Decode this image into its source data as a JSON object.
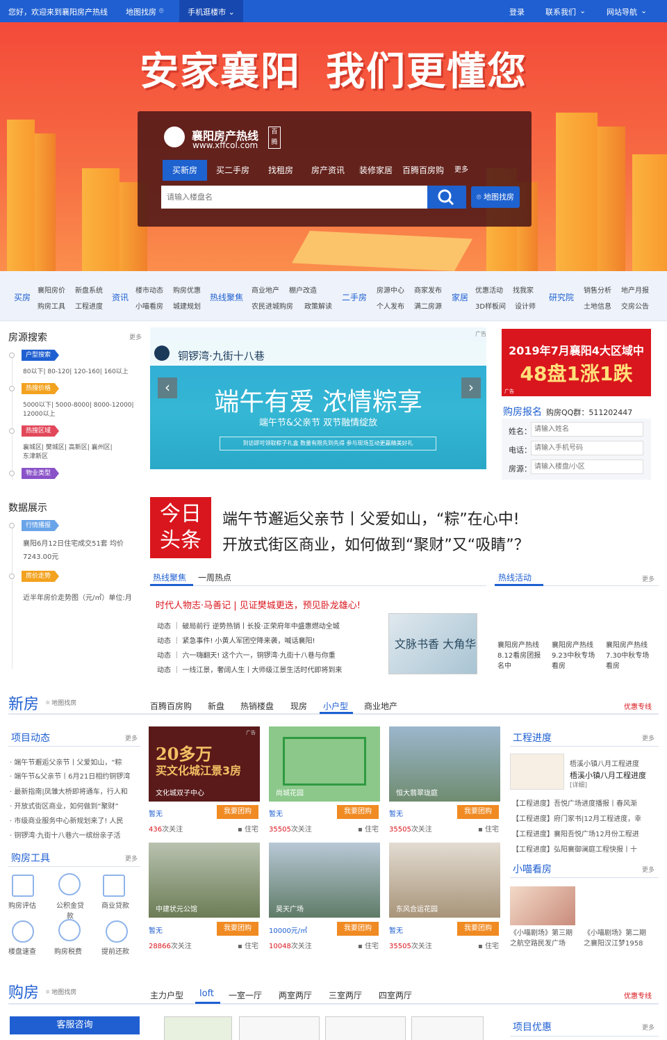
{
  "topbar": {
    "welcome": "您好，欢迎来到襄阳房产热线",
    "map_search": "地图找房",
    "mobile": "手机逛楼市",
    "login": "登录",
    "contact": "联系我们",
    "site_nav": "网站导航"
  },
  "hero": {
    "slogan_left": "安家襄阳",
    "slogan_right": "我们更懂您",
    "logo_name": "襄阳房产热线",
    "logo_url": "www.xffcol.com",
    "logo_seal": "百腾",
    "tabs": [
      "买新房",
      "买二手房",
      "找租房",
      "房产资讯",
      "装修家居",
      "百腾百房购",
      "更多"
    ],
    "search_placeholder": "请输入楼盘名",
    "map_button": "地图找房"
  },
  "catnav": [
    {
      "title": "买房",
      "items": [
        "襄阳房价",
        "新盘系统",
        "购房工具",
        "工程进度"
      ]
    },
    {
      "title": "资讯",
      "items": [
        "楼市动态",
        "购房优惠",
        "小喵看房",
        "城建规划"
      ]
    },
    {
      "title": "热线聚焦",
      "items": [
        "商业地产",
        "棚户改造",
        "农民进城购房",
        "政策解读"
      ]
    },
    {
      "title": "二手房",
      "items": [
        "房源中心",
        "商家发布",
        "个人发布",
        "满二房源"
      ]
    },
    {
      "title": "家居",
      "items": [
        "优惠活动",
        "找我家",
        "3D样板间",
        "设计师"
      ]
    },
    {
      "title": "研究院",
      "items": [
        "销售分析",
        "地产月报",
        "土地信息",
        "交房公告"
      ]
    }
  ],
  "house_search": {
    "title": "房源搜索",
    "more": "更多",
    "groups": [
      {
        "tag": "户型搜索",
        "color": "#1f5fd1",
        "lines": [
          "80以下| 80-120| 120-160| 160以上"
        ]
      },
      {
        "tag": "热搜价格",
        "color": "#f3a21f",
        "lines": [
          "5000以下| 5000-8000| 8000-12000|",
          "12000以上"
        ]
      },
      {
        "tag": "热搜区域",
        "color": "#e2485a",
        "lines": [
          "襄城区| 樊城区| 高新区| 襄州区|",
          "东津新区"
        ]
      },
      {
        "tag": "物业类型",
        "color": "#8a52c9",
        "lines": []
      }
    ]
  },
  "data_show": {
    "title": "数据展示",
    "g1": {
      "tag": "行情播报",
      "color": "#6aa4e8",
      "lines": [
        "襄阳6月12日住宅成交51套 均价",
        "7243.00元"
      ]
    },
    "g2": {
      "tag": "房价走势",
      "color": "#f3a21f",
      "lines": [
        "近半年房价走势图（元/㎡）单位:月"
      ]
    }
  },
  "banner": {
    "brand": "铜锣湾·九街十八巷",
    "headline": "端午有爱 浓情粽享",
    "sub": "端午节&父亲节 双节融情绽放",
    "note": "到访即可领取粽子礼盒 数量有限先到先得 参与现场互动更赢精美好礼",
    "ad": "广告"
  },
  "red_ad": {
    "line1": "2019年7月襄阳4大区域中",
    "line2": "48盘1涨1跌",
    "ad": "广告"
  },
  "signup": {
    "title": "购房报名",
    "qq": "购房QQ群：511202447",
    "fields": [
      {
        "label": "姓名：",
        "placeholder": "请输入姓名"
      },
      {
        "label": "电话：",
        "placeholder": "请输入手机号码"
      },
      {
        "label": "房源：",
        "placeholder": "请输入楼盘/小区"
      }
    ]
  },
  "headline": {
    "box1": "今日",
    "box2": "头条",
    "line1": "端午节邂逅父亲节丨父爱如山，“粽”在心中!",
    "line2": "开放式街区商业，如何做到“聚财”又“吸睛”？"
  },
  "focus": {
    "tab1": "热线聚焦",
    "tab2": "一周热点",
    "lead": "时代人物志·马善记 | 见证樊城更迭，预见卧龙雄心!",
    "items": [
      "动态 ｜ 破局前行 逆势热销丨长投·正荣府年中盛惠燃动全城",
      "动态 ｜ 紧急事件! 小黄人军团空降来袭，喊话襄阳!",
      "动态 ｜ 六一嗨翻天! 这个六一，铜锣湾·九街十八巷与你重",
      "动态 ｜ 一线江景，奢阔人生丨大师级江景生活时代即将到来"
    ],
    "img_text": "文脉书香 大角华"
  },
  "activity": {
    "title": "热线活动",
    "more": "更多",
    "items": [
      [
        "襄阳房产热线",
        "8.12看房团报",
        "名中"
      ],
      [
        "襄阳房产热线",
        "9.23中秋专场",
        "看房"
      ],
      [
        "襄阳房产热线",
        "7.30中秋专场",
        "看房"
      ]
    ]
  },
  "newhouse": {
    "title": "新房",
    "map": "地图找房",
    "tabs": [
      "百腾百房购",
      "新盘",
      "热销楼盘",
      "现房",
      "小户型",
      "商业地产"
    ],
    "active_tab": 4,
    "hotline": "优惠专线"
  },
  "projects": {
    "title": "项目动态",
    "more": "更多",
    "items": [
      "· 端午节邂逅父亲节丨父爱如山，“粽",
      "· 端午节&父亲节丨6月21日相约铜锣湾",
      "· 最新指南|凤雏大桥即将通车，行人和",
      "· 开放式街区商业，如何做到“聚财”",
      "· 市级商业服务中心新规划来了! 人民",
      "· 铜锣湾·九街十八巷六一缤纷亲子活"
    ]
  },
  "tools": {
    "title": "购房工具",
    "more": "更多",
    "items": [
      "购房评估",
      "公积金贷款",
      "商业贷款",
      "楼盘速查",
      "购房税费",
      "提前还款"
    ]
  },
  "cards": [
    {
      "caption": "文化城双子中心",
      "img_big": "20多万",
      "img_sub": "买文化城江景3房",
      "price": "暂无",
      "count": "436",
      "type": "住宅"
    },
    {
      "caption": "尚城花园",
      "price": "暂无",
      "count": "35505",
      "type": "住宅"
    },
    {
      "caption": "恒大翡翠珑庭",
      "price": "暂无",
      "count": "35505",
      "type": "住宅"
    },
    {
      "caption": "中建状元公馆",
      "price": "暂无",
      "count": "28866",
      "type": "住宅"
    },
    {
      "caption": "昊天广场",
      "price": "10000元/㎡",
      "count": "10048",
      "type": "住宅"
    },
    {
      "caption": "东风合运花园",
      "price": "暂无",
      "count": "35505",
      "type": "住宅"
    }
  ],
  "card_labels": {
    "group": "我要团购",
    "follow": "次关注",
    "ad": "广告"
  },
  "progress": {
    "title": "工程进度",
    "more": "更多",
    "feature1": "梧溪小镇八月工程进度",
    "feature2": "梧溪小镇八月工程进度",
    "detail": "[详细]",
    "items": [
      "【工程进度】吾悦广场进度播报丨春风渐",
      "【工程进度】府门家书|12月工程进度，幸",
      "【工程进度】襄阳吾悦广场12月份工程进",
      "【工程进度】弘阳襄御澜庭工程快报丨十"
    ]
  },
  "miao": {
    "title": "小喵看房",
    "more": "更多",
    "items": [
      [
        "《小喵剧场》第三期",
        "之航空路民发广场"
      ],
      [
        "《小喵剧场》第二期",
        "之襄阳汉江梦1958"
      ]
    ]
  },
  "shop": {
    "title": "购房",
    "map": "地图找房",
    "tabs": [
      "主力户型",
      "loft",
      "一室一厅",
      "两室两厅",
      "三室两厅",
      "四室两厅"
    ],
    "active_tab": 1,
    "hotline": "优惠专线",
    "service": "客服咨询",
    "proj": "项目优惠",
    "more": "更多"
  }
}
